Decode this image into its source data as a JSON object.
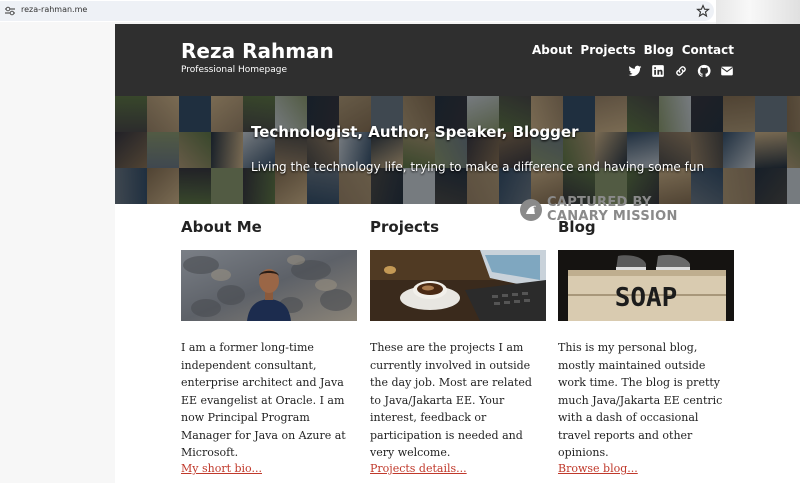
{
  "browser": {
    "url": "reza-rahman.me"
  },
  "site": {
    "title": "Reza Rahman",
    "tagline": "Professional Homepage",
    "nav": [
      "About",
      "Projects",
      "Blog",
      "Contact"
    ],
    "social_icons": [
      "twitter-icon",
      "linkedin-icon",
      "link-icon",
      "github-icon",
      "mail-icon"
    ]
  },
  "hero": {
    "title": "Technologist, Author, Speaker, Blogger",
    "subtitle": "Living the technology life, trying to make a difference and having some fun"
  },
  "columns": [
    {
      "heading": "About Me",
      "image": "portrait-photo",
      "text": "I am a former long-time independent consultant, enterprise architect and Java EE evangelist at Oracle. I am now Principal Program Manager for Java on Azure at Microsoft.",
      "link": "My short bio..."
    },
    {
      "heading": "Projects",
      "image": "coffee-laptop-photo",
      "text": "These are the projects I am currently involved in outside the day job. Most are related to Java/Jakarta EE. Your interest, feedback or participation is needed and very welcome.",
      "link": "Projects details..."
    },
    {
      "heading": "Blog",
      "image": "soap-box-photo",
      "text": "This is my personal blog, mostly maintained outside work time. The blog is pretty much Java/Jakarta EE centric with a dash of occasional travel reports and other opinions.",
      "link": "Browse blog..."
    }
  ],
  "watermark": {
    "line1": "CAPTURED BY",
    "line2": "CANARY MISSION"
  },
  "colors": {
    "masthead": "#2f2f2f",
    "link": "#c0392b",
    "watermark": "#8a8a8a"
  }
}
